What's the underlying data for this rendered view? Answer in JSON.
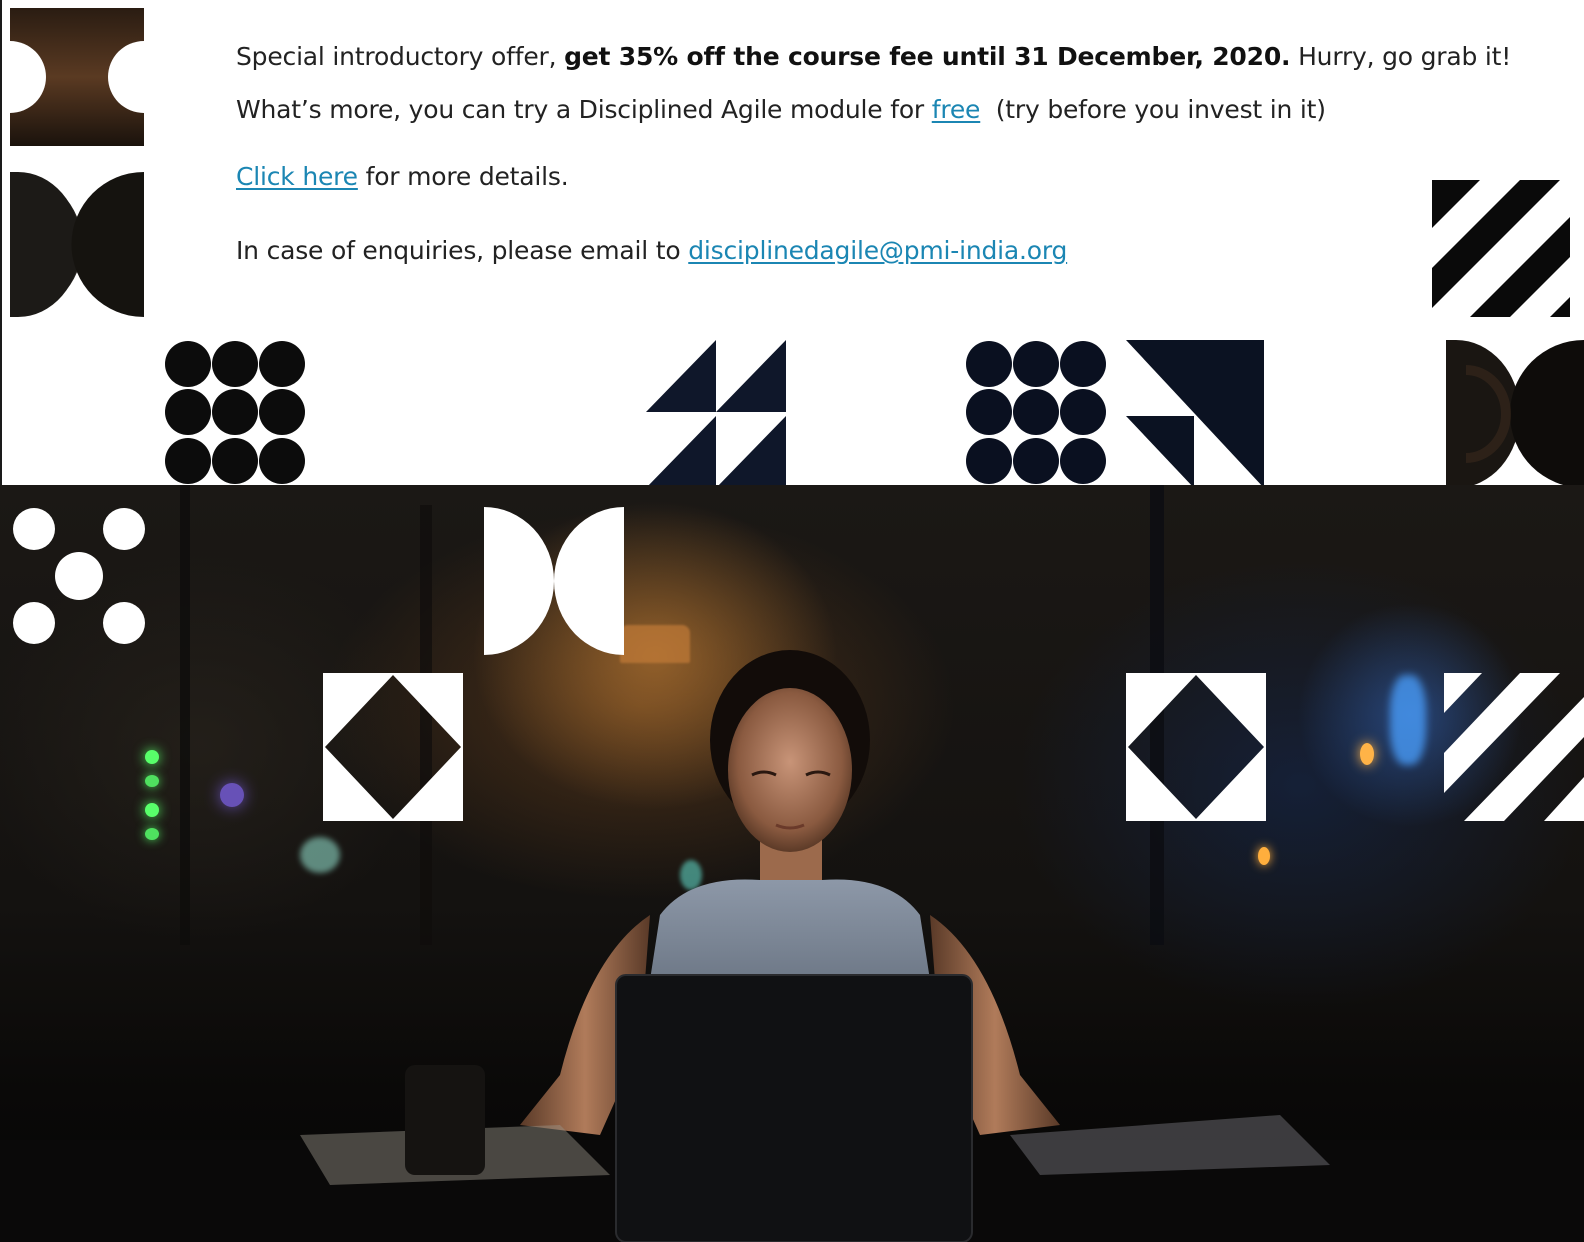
{
  "offer": {
    "prefix": "Special introductory offer, ",
    "highlight": "get 35% off the course fee until 31 December, 2020.",
    "suffix": " Hurry, go grab it!"
  },
  "module": {
    "prefix": "What’s more, you can try a Disciplined Agile module for ",
    "link": "free",
    "suffix": "  (try before you invest in it)"
  },
  "details": {
    "link": "Click here",
    "suffix": " for more details."
  },
  "enquiries": {
    "prefix": "In case of enquiries, please email to ",
    "email": "disciplinedagile@pmi-india.org"
  },
  "colors": {
    "link": "#1b86b3",
    "navy": "#0d1424",
    "text": "#222222"
  },
  "decorations": [
    "half-circles-tile",
    "half-circles-tile",
    "diagonal-stripes-tile",
    "circle-grid-tile",
    "triangles-tile",
    "circle-grid-tile",
    "corner-triangles-tile",
    "half-circles-tile",
    "four-dots-tile",
    "half-circles-tile",
    "diamond-tile",
    "diamond-tile",
    "diagonal-stripes-tile"
  ],
  "photo": {
    "subject": "woman working on laptop at night"
  }
}
